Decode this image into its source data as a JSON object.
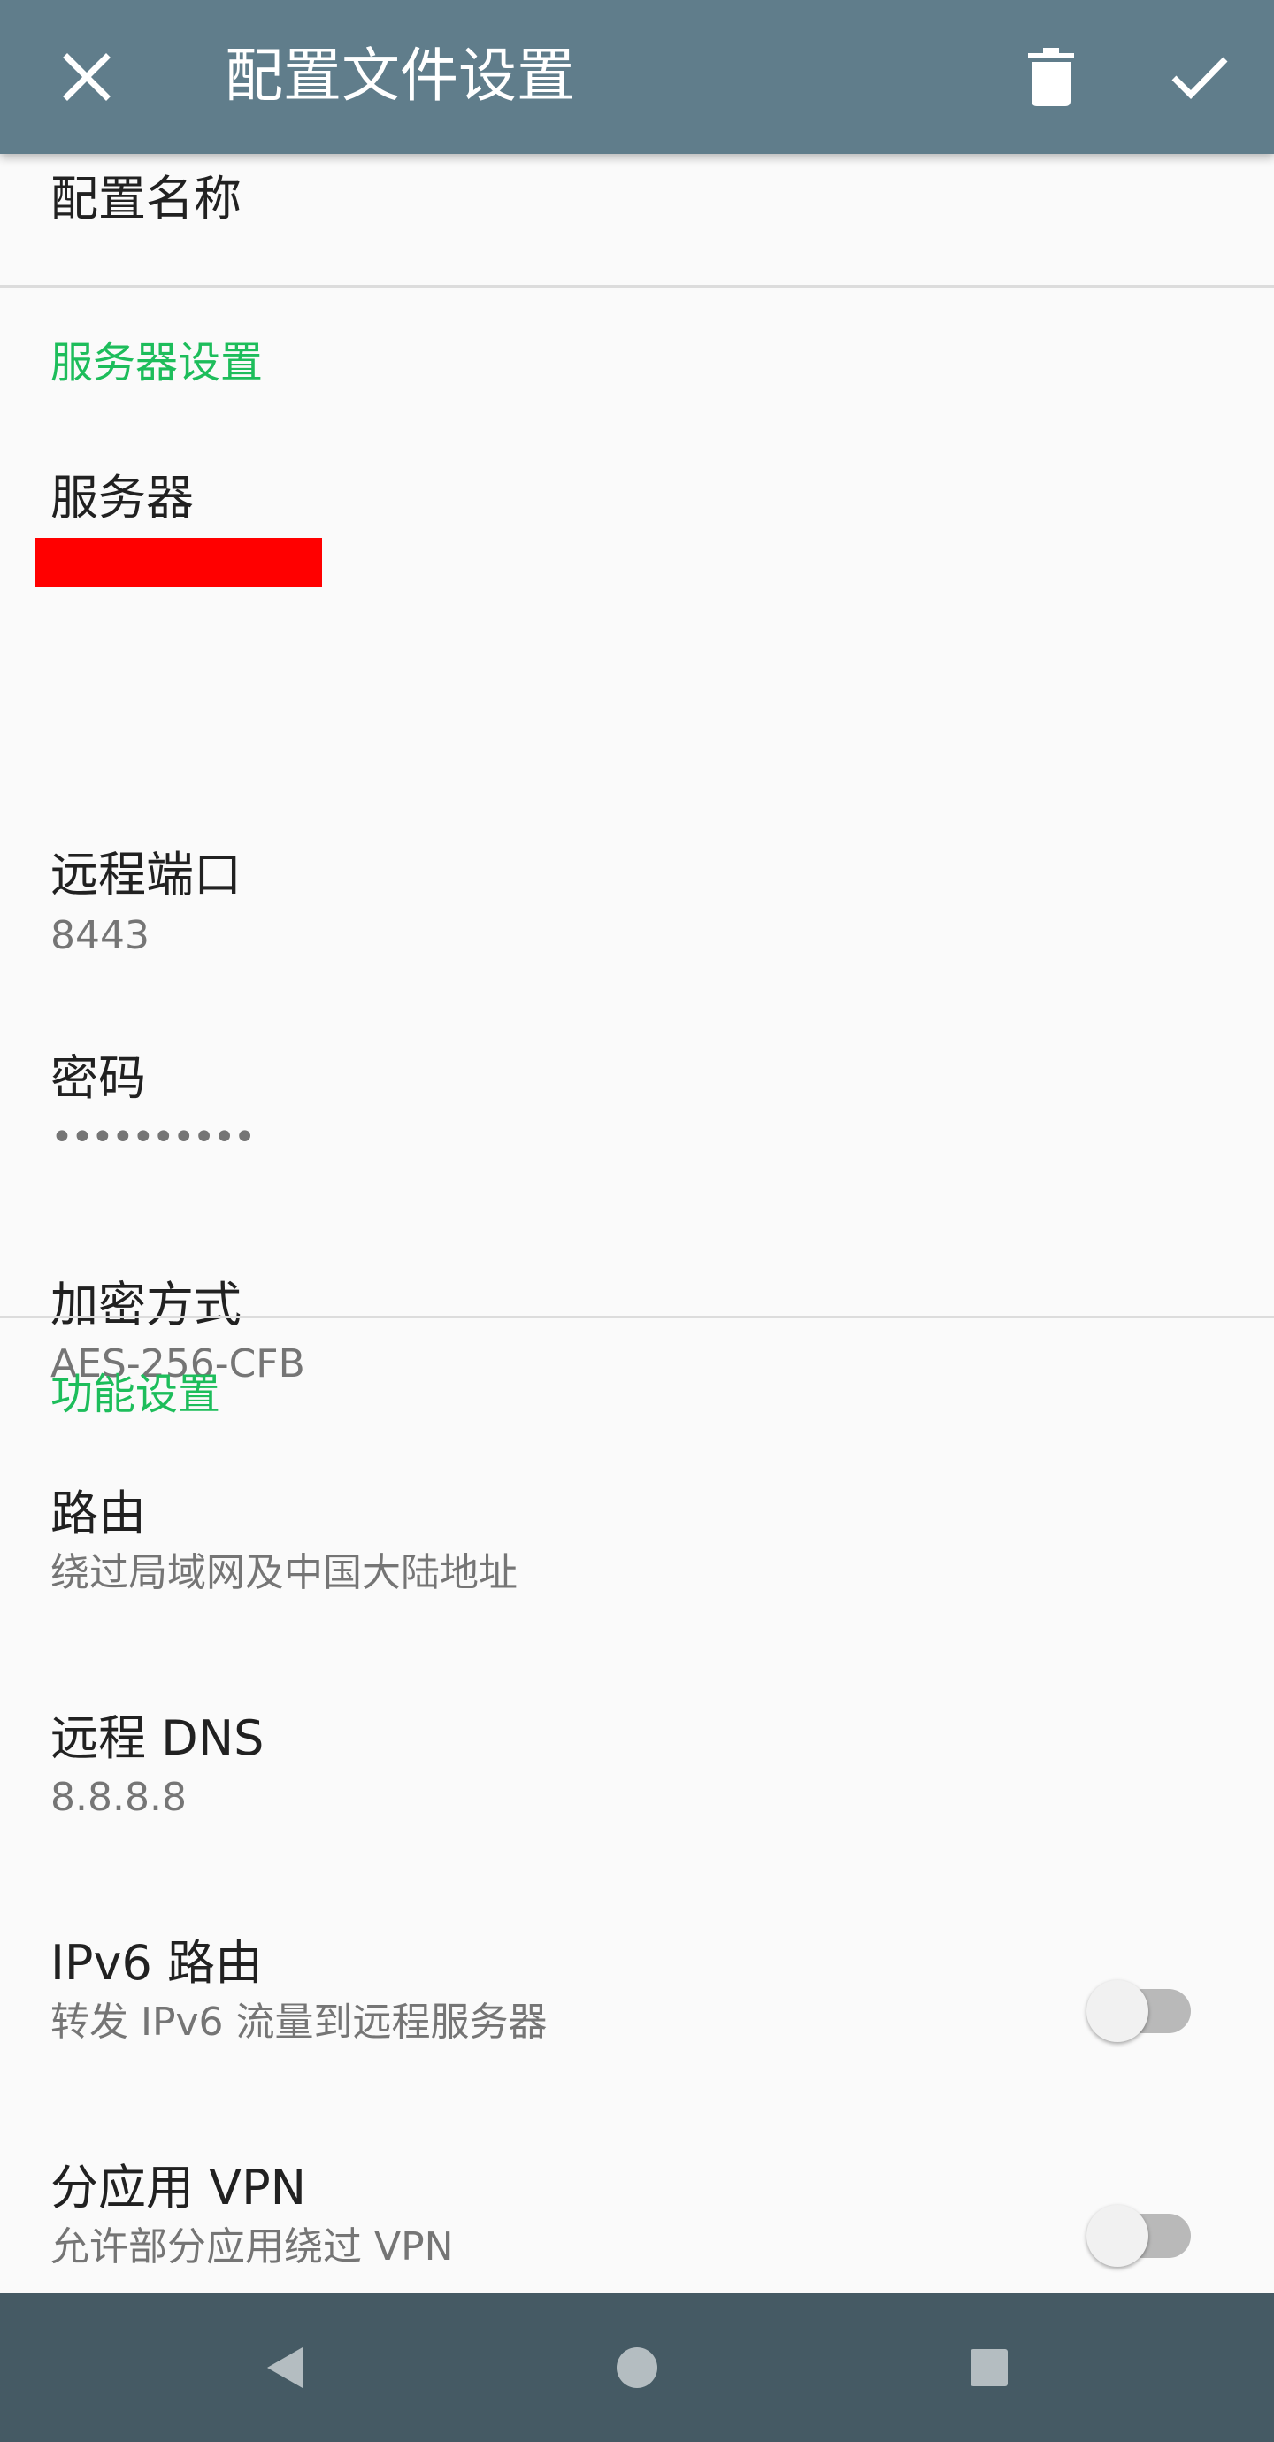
{
  "toolbar": {
    "title": "配置文件设置",
    "close_icon": "close-icon",
    "delete_icon": "trash-icon",
    "confirm_icon": "check-icon",
    "background_color": "#607d8b"
  },
  "profile": {
    "name_label": "配置名称"
  },
  "server_settings": {
    "category": "服务器设置",
    "server": {
      "title": "服务器",
      "summary_redacted": true
    },
    "remote_port": {
      "title": "远程端口",
      "summary": "8443"
    },
    "password": {
      "title": "密码",
      "summary": "••••••••••"
    },
    "encryption": {
      "title": "加密方式",
      "summary": "AES-256-CFB"
    }
  },
  "feature_settings": {
    "category": "功能设置",
    "route": {
      "title": "路由",
      "summary": "绕过局域网及中国大陆地址"
    },
    "remote_dns": {
      "title": "远程 DNS",
      "summary": "8.8.8.8"
    },
    "ipv6_route": {
      "title": "IPv6 路由",
      "summary": "转发 IPv6 流量到远程服务器",
      "enabled": false
    },
    "per_app_vpn": {
      "title": "分应用 VPN",
      "summary": "允许部分应用绕过 VPN",
      "enabled": false
    }
  },
  "colors": {
    "accent": "#1dbd5b",
    "redaction": "#ff0000",
    "nav_bar": "#455a64"
  },
  "nav": {
    "back_icon": "back-triangle-icon",
    "home_icon": "home-circle-icon",
    "recents_icon": "recents-square-icon"
  }
}
